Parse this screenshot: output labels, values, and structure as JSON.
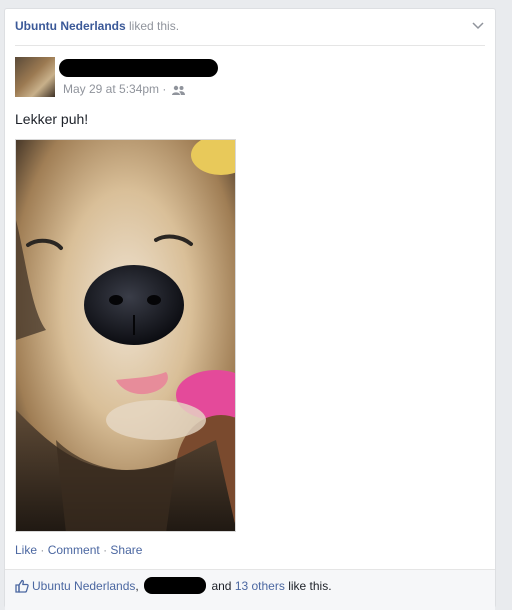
{
  "story": {
    "actor": "Ubuntu Nederlands",
    "verb": "liked this."
  },
  "post": {
    "timestamp": "May 29 at 5:34pm",
    "separator": "·",
    "text": "Lekker puh!"
  },
  "actions": {
    "like": "Like",
    "comment": "Comment",
    "share": "Share",
    "separator": "·"
  },
  "likes": {
    "first_liker": "Ubuntu Nederlands",
    "comma": ",",
    "and_text": "and",
    "others_link": "13 others",
    "suffix": "like this."
  },
  "colors": {
    "link": "#4b67a1",
    "brand": "#3b5998",
    "muted": "#90949c"
  }
}
